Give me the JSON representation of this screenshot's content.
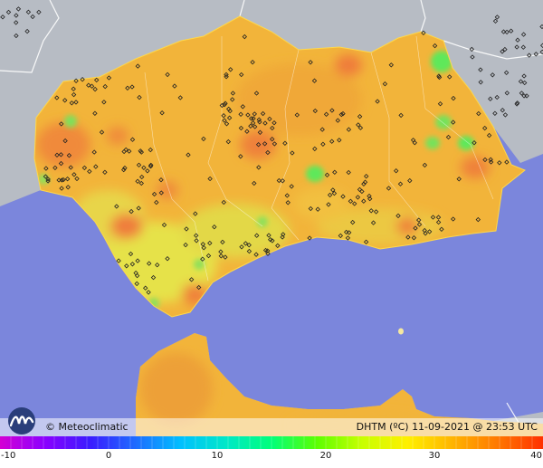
{
  "branding": {
    "credit": "© Meteoclimatic",
    "logo_icon": "meteoclimatic-logo-icon"
  },
  "caption": "DHTM (ºC)  11-09-2021 @ 23:53 UTC",
  "scale": {
    "min": -10,
    "max": 40,
    "tick_labels": [
      "-10",
      "0",
      "10",
      "20",
      "30",
      "40"
    ],
    "tick_values": [
      -10,
      0,
      10,
      20,
      30,
      40
    ],
    "colors": [
      "#d400d4",
      "#8a00ff",
      "#3a1cff",
      "#1e6cff",
      "#00c0ff",
      "#00e8c8",
      "#00ff7a",
      "#5cff00",
      "#c8ff00",
      "#fff000",
      "#ffb400",
      "#ff7800",
      "#ff3000"
    ]
  },
  "colors": {
    "sea": "#7b86dc",
    "land_outside": "#b7bcc4",
    "land_andalucia": "#f2b43a",
    "border": "#ffffff"
  },
  "stations": 320
}
